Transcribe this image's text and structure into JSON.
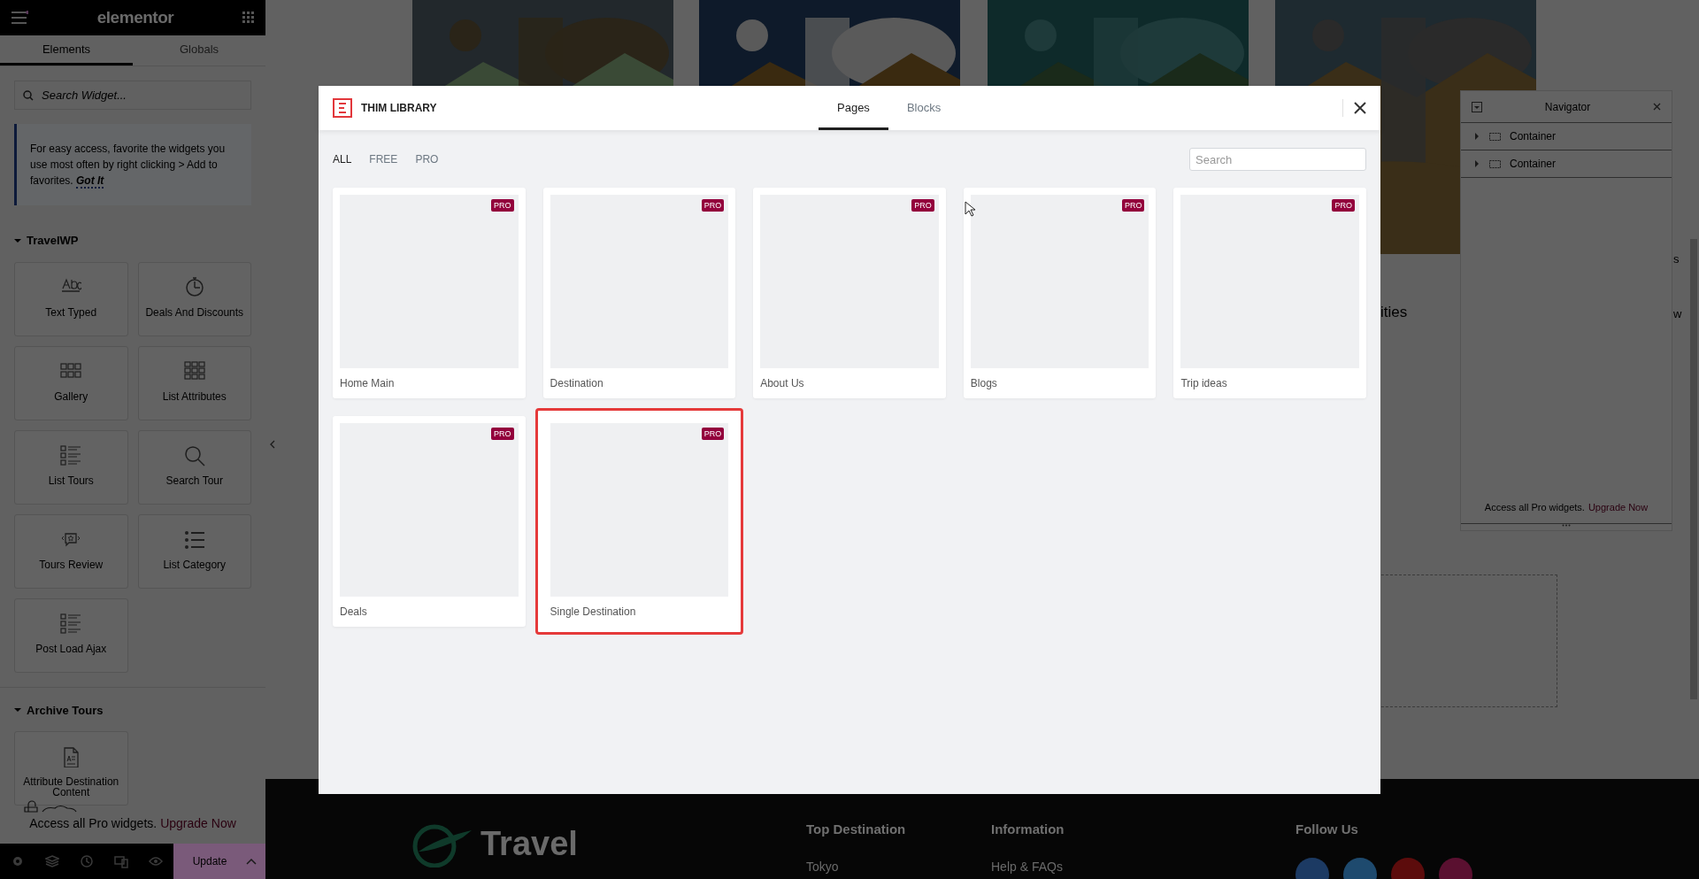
{
  "sidebar": {
    "logo": "elementor",
    "tabs": [
      {
        "label": "Elements",
        "selected": true
      },
      {
        "label": "Globals",
        "selected": false
      }
    ],
    "search": {
      "placeholder": "Search Widget..."
    },
    "tip": {
      "text": "For easy access, favorite the widgets you use most often by right clicking > Add to favorites.",
      "link": "Got It"
    },
    "sections": [
      {
        "title": "TravelWP",
        "expanded": true,
        "widgets": [
          {
            "label": "Text Typed"
          },
          {
            "label": "Deals And Discounts"
          },
          {
            "label": "Gallery"
          },
          {
            "label": "List Attributes"
          },
          {
            "label": "List Tours"
          },
          {
            "label": "Search Tour"
          },
          {
            "label": "Tours Review"
          },
          {
            "label": "List Category"
          },
          {
            "label": "Post Load Ajax"
          }
        ]
      },
      {
        "title": "Archive Tours",
        "expanded": true,
        "widgets": [
          {
            "label": "Attribute Destination Content"
          }
        ]
      }
    ],
    "promo": {
      "text": "Access all Pro widgets.",
      "link": "Upgrade Now"
    },
    "footer": {
      "button": "Update"
    }
  },
  "page": {
    "fragments": [
      "ities",
      "s",
      "w"
    ],
    "footer": {
      "logo": "Travel",
      "columns": [
        {
          "title": "Top Destination",
          "link": "Tokyo"
        },
        {
          "title": "Information",
          "link": "Help & FAQs"
        },
        {
          "title": "Follow Us"
        }
      ],
      "socials": [
        {
          "color": "#1c3a63"
        },
        {
          "color": "#1e4a6e"
        },
        {
          "color": "#5c0c0c"
        },
        {
          "color": "#5a1030"
        }
      ]
    }
  },
  "library": {
    "title": "THIM LIBRARY",
    "tabs": [
      {
        "label": "Pages",
        "selected": true
      },
      {
        "label": "Blocks",
        "selected": false
      }
    ],
    "filters": [
      {
        "label": "ALL",
        "selected": true
      },
      {
        "label": "FREE",
        "selected": false
      },
      {
        "label": "PRO",
        "selected": false
      }
    ],
    "search": {
      "placeholder": "Search"
    },
    "templates": [
      {
        "name": "Home Main",
        "badge": "PRO",
        "selected": false
      },
      {
        "name": "Destination",
        "badge": "PRO",
        "selected": false
      },
      {
        "name": "About Us",
        "badge": "PRO",
        "selected": false
      },
      {
        "name": "Blogs",
        "badge": "PRO",
        "selected": false
      },
      {
        "name": "Trip ideas",
        "badge": "PRO",
        "selected": false
      },
      {
        "name": "Deals",
        "badge": "PRO",
        "selected": false
      },
      {
        "name": "Single Destination",
        "badge": "PRO",
        "selected": true
      }
    ]
  },
  "navigator": {
    "title": "Navigator",
    "items": [
      {
        "label": "Container",
        "expanded": false
      },
      {
        "label": "Container",
        "expanded": false
      }
    ],
    "promo": {
      "text": "Access all Pro widgets.",
      "link": "Upgrade Now"
    }
  }
}
